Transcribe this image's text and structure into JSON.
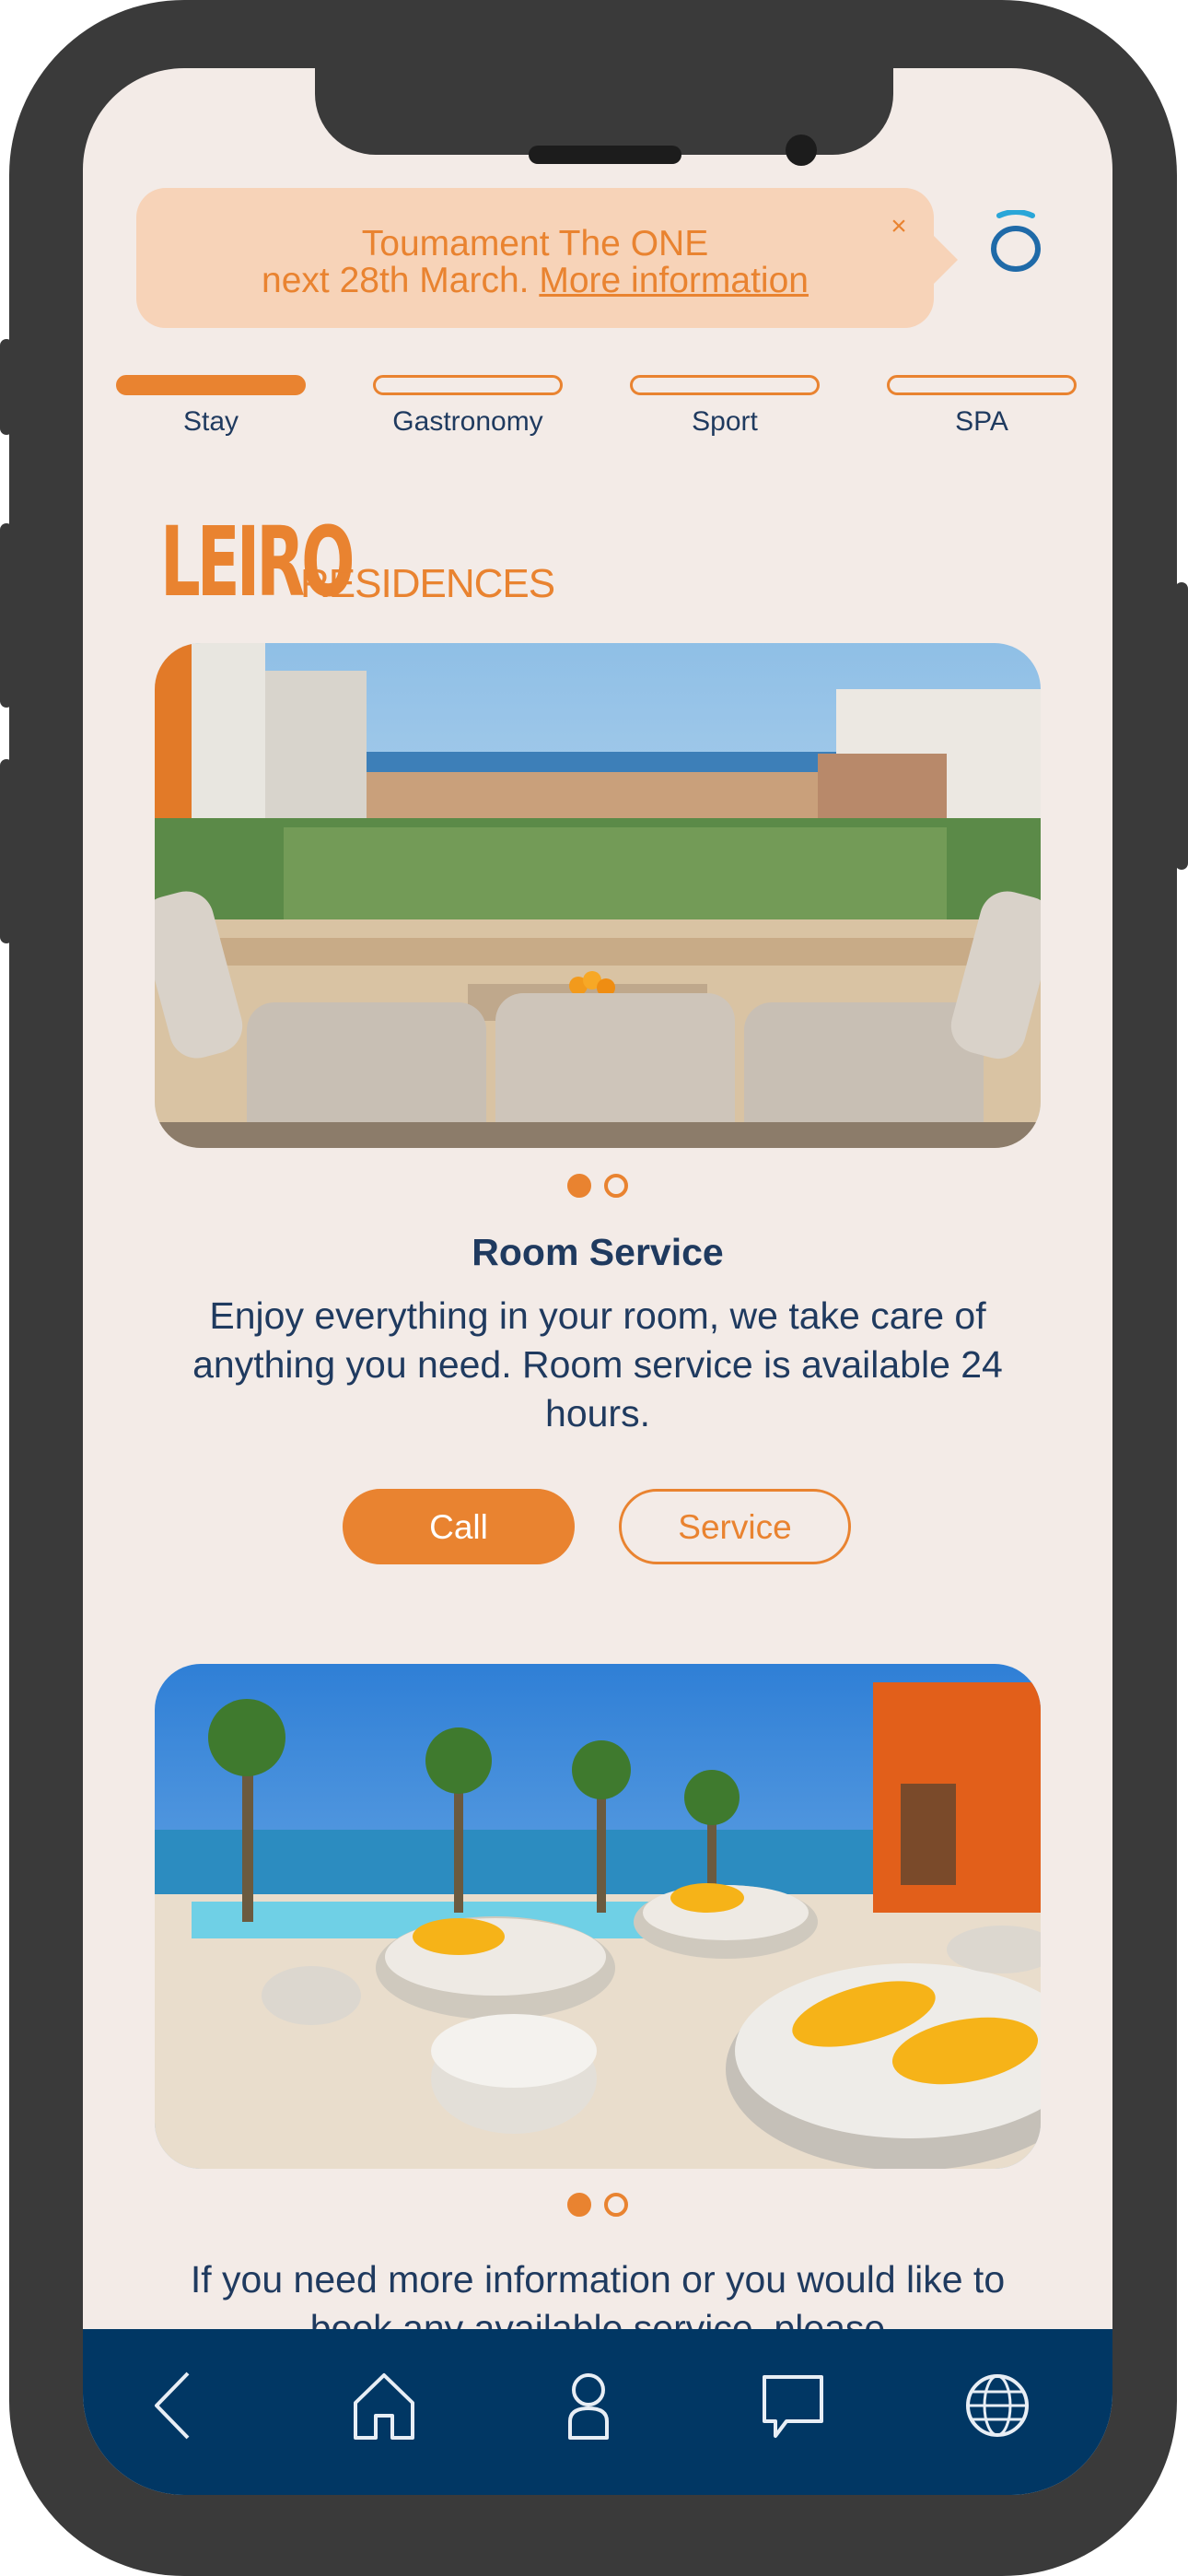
{
  "banner": {
    "line1": "Toumament The ONE",
    "line2_prefix": "next 28th March. ",
    "line2_link": "More information",
    "close_symbol": "×"
  },
  "brand_icon": "brand-o-icon",
  "tabs": [
    {
      "label": "Stay",
      "active": true
    },
    {
      "label": "Gastronomy",
      "active": false
    },
    {
      "label": "Sport",
      "active": false
    },
    {
      "label": "SPA",
      "active": false
    }
  ],
  "logo": {
    "big": "LEIRO",
    "small": "RESIDENCES"
  },
  "carousel1": {
    "image": "balcony-sea-view-photo",
    "active_dot": 0,
    "dot_count": 2
  },
  "room_service": {
    "title": "Room Service",
    "description": "Enjoy everything in your room, we take care of anything you need. Room service is available 24 hours.",
    "call_label": "Call",
    "service_label": "Service"
  },
  "carousel2": {
    "image": "pool-terrace-photo",
    "active_dot": 0,
    "dot_count": 2
  },
  "info_text": "If you need more information or you would like to book any available service, please",
  "bottom_nav": [
    "back-icon",
    "home-icon",
    "profile-icon",
    "chat-icon",
    "globe-icon"
  ],
  "colors": {
    "accent": "#e98330",
    "navy": "#013764",
    "text": "#1f3a5f",
    "background": "#f3ebe7",
    "banner": "#f7d3b8"
  }
}
